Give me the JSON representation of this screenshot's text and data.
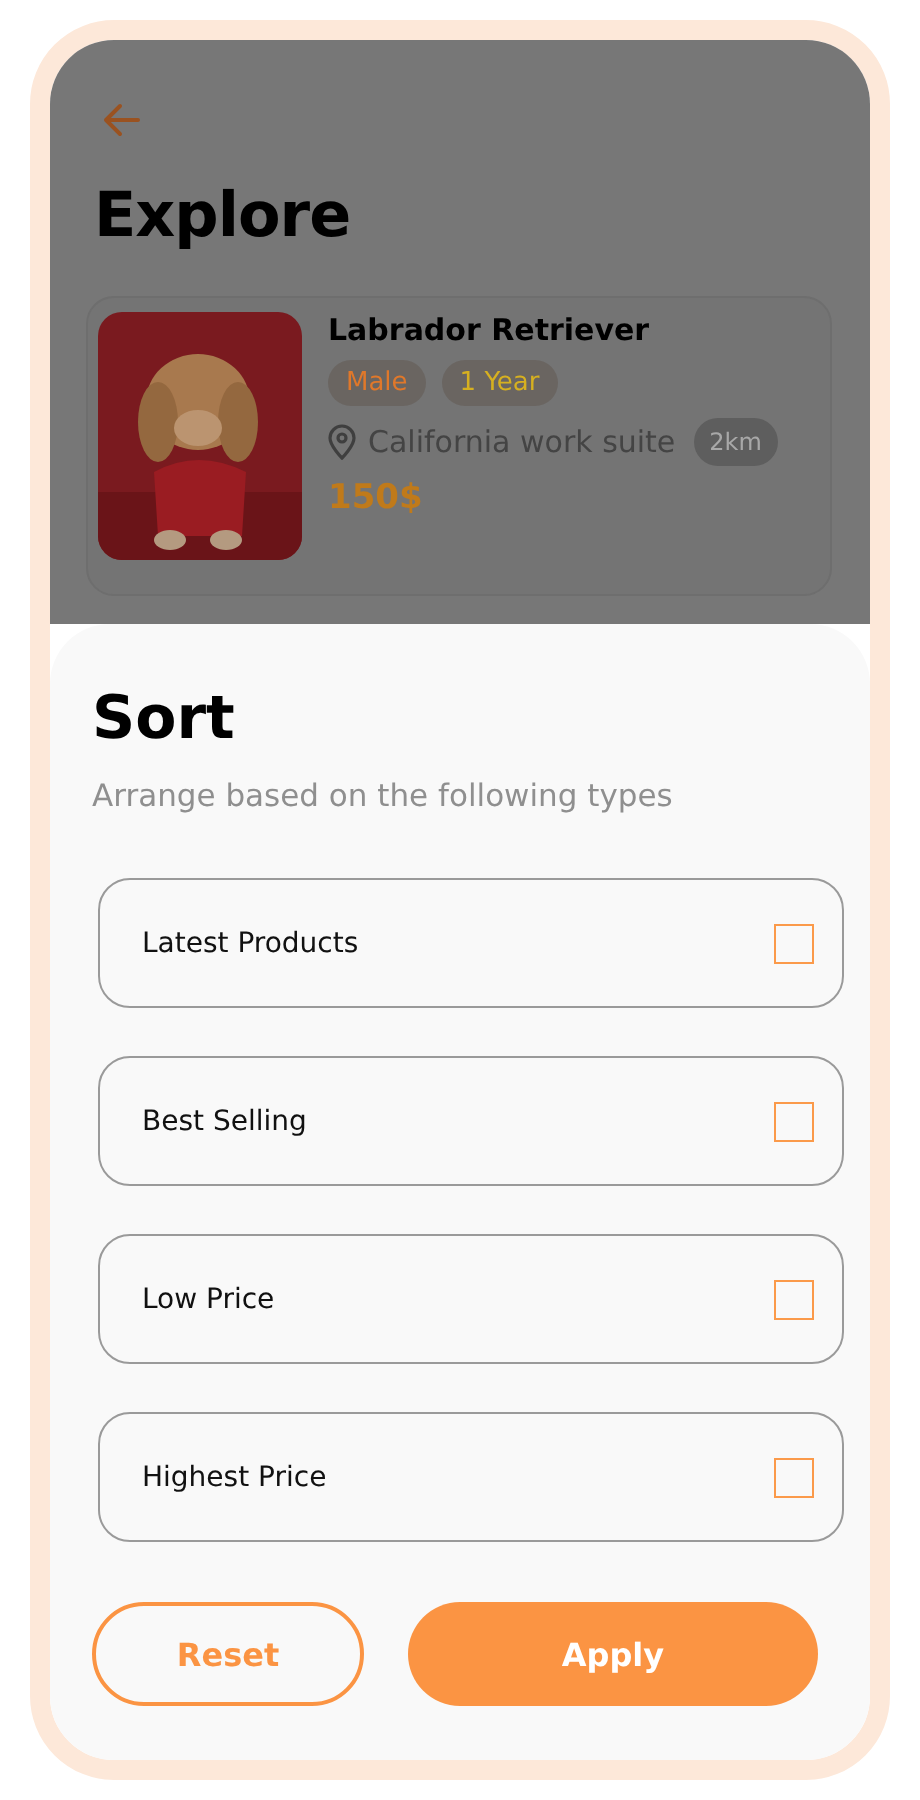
{
  "background": {
    "title": "Explore",
    "listing": {
      "name": "Labrador Retriever",
      "tags": [
        {
          "label": "Male",
          "color": "#e0782a"
        },
        {
          "label": "1 Year",
          "color": "#d6b020"
        }
      ],
      "location": "California work suite",
      "distance": "2km",
      "price": "150$"
    }
  },
  "sheet": {
    "title": "Sort",
    "subtitle": "Arrange based on the following types",
    "options": [
      {
        "label": "Latest Products",
        "checked": false
      },
      {
        "label": "Best Selling",
        "checked": false
      },
      {
        "label": "Low Price",
        "checked": false
      },
      {
        "label": "Highest Price",
        "checked": false
      }
    ],
    "buttons": [
      {
        "label": "Reset",
        "kind": "outline"
      },
      {
        "label": "Apply",
        "kind": "filled"
      }
    ]
  }
}
